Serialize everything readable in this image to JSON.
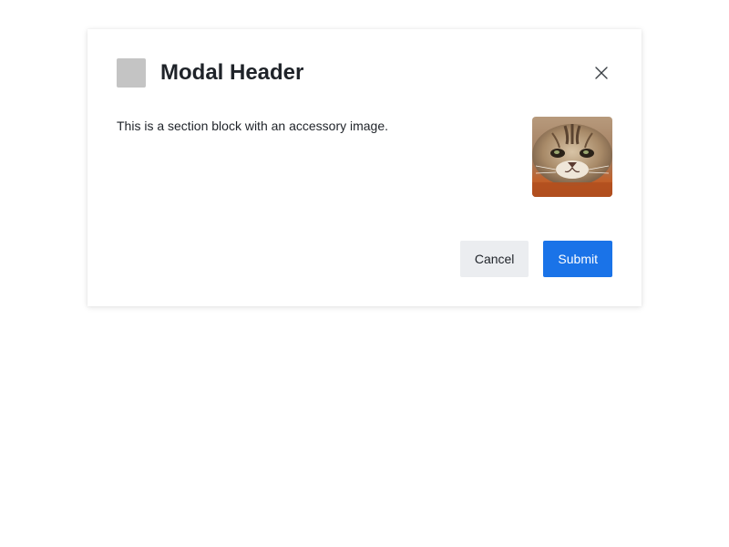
{
  "modal": {
    "title": "Modal Header",
    "header_icon": "placeholder-square-icon",
    "close_icon": "close-icon"
  },
  "section": {
    "text": "This is a section block with an accessory image.",
    "accessory_image": "cat-photo"
  },
  "footer": {
    "cancel_label": "Cancel",
    "submit_label": "Submit"
  },
  "colors": {
    "primary": "#1a73e8",
    "secondary_button": "#ebedf0",
    "text": "#1f2329",
    "icon_placeholder": "#c4c4c4"
  }
}
